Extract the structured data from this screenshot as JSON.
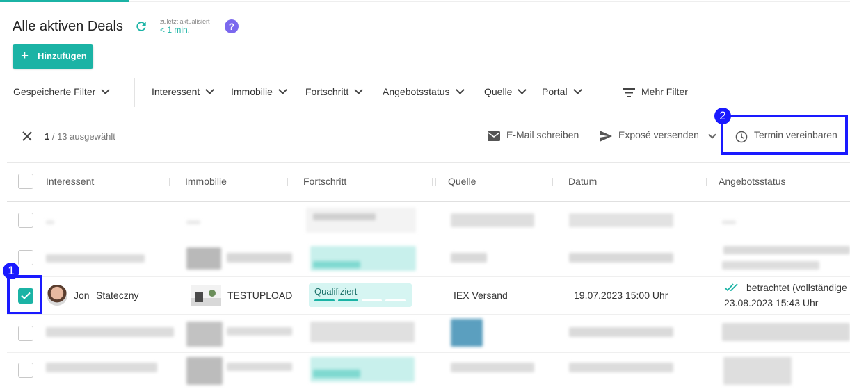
{
  "header": {
    "title": "Alle aktiven Deals",
    "updated_label": "zuletzt aktualisiert",
    "updated_value": "< 1 min.",
    "help": "?"
  },
  "add_button": {
    "label": "Hinzufügen"
  },
  "filters": [
    "Gespeicherte Filter",
    "Interessent",
    "Immobilie",
    "Fortschritt",
    "Angebotsstatus",
    "Quelle",
    "Portal"
  ],
  "more_filters": "Mehr Filter",
  "selection": {
    "count": "1",
    "total": " / 13 ausgewählt"
  },
  "actions": {
    "email": "E-Mail schreiben",
    "expose": "Exposé versenden",
    "appointment": "Termin vereinbaren"
  },
  "annotations": {
    "badge_1": "1",
    "badge_2": "2"
  },
  "table": {
    "columns": [
      "Interessent",
      "Immobilie",
      "Fortschritt",
      "Quelle",
      "Datum",
      "Angebotsstatus"
    ],
    "selected_row": {
      "first_name": "Jon",
      "last_name": "Stateczny",
      "property": "TESTUPLOAD",
      "progress_label": "Qualifiziert",
      "progress_fraction": 0.4,
      "source": "IEX Versand",
      "date": "19.07.2023 15:00 Uhr",
      "offer_status": "betrachtet (vollständige",
      "offer_date": "23.08.2023 15:43 Uhr"
    }
  },
  "colors": {
    "accent": "#1bb3a5",
    "annotation": "#1a1aff",
    "help": "#7b68ee"
  }
}
